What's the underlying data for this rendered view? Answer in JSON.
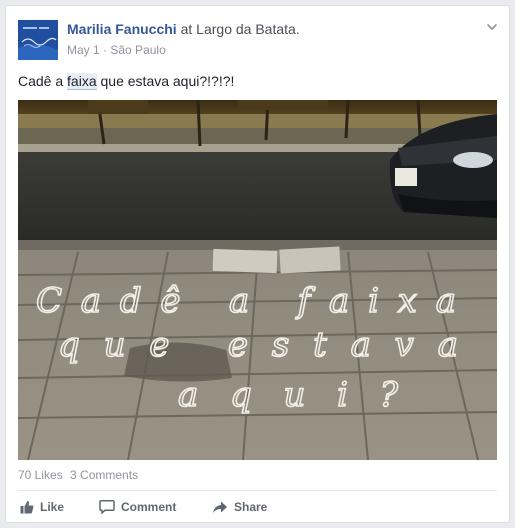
{
  "post": {
    "author": "Marilia Fanucchi",
    "at_word": "at",
    "place": "Largo da Batata.",
    "date": "May 1",
    "separator": "·",
    "location": "São Paulo",
    "text_before": "Cadê a ",
    "text_highlight": "faixa",
    "text_after": " que estava aqui?!?!?!",
    "photo_writing": [
      "Cadê a faixa",
      "que estava",
      "aqui?"
    ]
  },
  "stats": {
    "likes": "70 Likes",
    "comments": "3 Comments"
  },
  "actions": {
    "like": "Like",
    "comment": "Comment",
    "share": "Share"
  },
  "icons": {
    "avatar": "profile-picture",
    "chevron": "chevron-down-icon",
    "like": "thumbs-up-icon",
    "comment": "speech-bubble-icon",
    "share": "share-arrow-icon"
  },
  "colors": {
    "link": "#365899",
    "muted": "#90949c",
    "text": "#1d2129",
    "action": "#616770"
  }
}
